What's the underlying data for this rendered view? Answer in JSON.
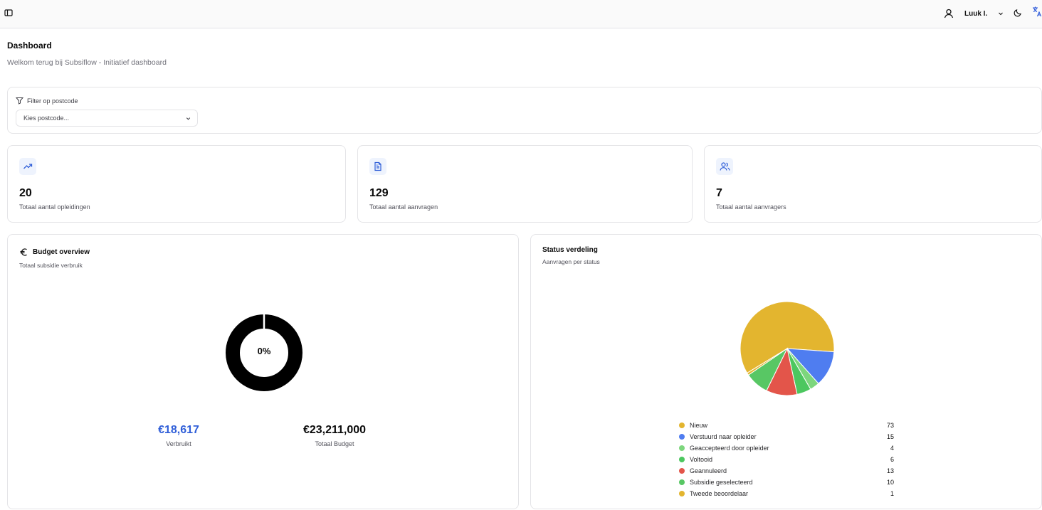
{
  "header": {
    "user_name": "Luuk I."
  },
  "page": {
    "title": "Dashboard",
    "subtitle": "Welkom terug bij Subsiflow - Initiatief dashboard"
  },
  "filter": {
    "label": "Filter op postcode",
    "placeholder": "Kies postcode..."
  },
  "stats": [
    {
      "value": "20",
      "label": "Totaal aantal opleidingen",
      "icon": "trending-up-icon"
    },
    {
      "value": "129",
      "label": "Totaal aantal aanvragen",
      "icon": "file-text-icon"
    },
    {
      "value": "7",
      "label": "Totaal aantal aanvragers",
      "icon": "users-icon"
    }
  ],
  "budget": {
    "title": "Budget overview",
    "subtitle": "Totaal subsidie verbruik",
    "percent_label": "0%",
    "used_fraction": 0.0008,
    "used_amount": "€18,617",
    "used_caption": "Verbruikt",
    "total_amount": "€23,211,000",
    "total_caption": "Totaal Budget",
    "used_color": "#2f5ed8",
    "ring_color": "#000000"
  },
  "status": {
    "title": "Status verdeling",
    "subtitle": "Aanvragen per status"
  },
  "chart_data": {
    "type": "pie",
    "categories": [
      "Nieuw",
      "Verstuurd naar opleider",
      "Geaccepteerd door opleider",
      "Voltooid",
      "Geannuleerd",
      "Subsidie geselecteerd",
      "Tweede beoordelaar"
    ],
    "values": [
      73,
      15,
      4,
      6,
      13,
      10,
      1
    ],
    "colors": [
      "#e3b52f",
      "#4f7df0",
      "#7dd67d",
      "#4cc75f",
      "#e3554a",
      "#58c764",
      "#e3b52f"
    ],
    "legend": "bottom"
  }
}
